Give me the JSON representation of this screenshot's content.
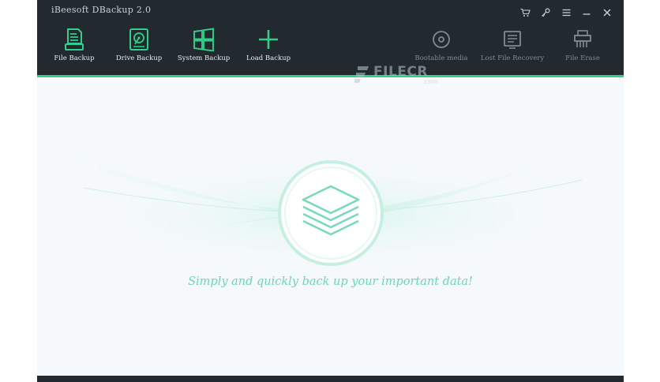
{
  "window": {
    "title": "iBeesoft DBackup 2.0",
    "controls": [
      "cart-icon",
      "key-icon",
      "menu-icon",
      "minimize-icon",
      "close-icon"
    ]
  },
  "toolbar": {
    "primary": [
      {
        "label": "File Backup",
        "icon": "file-backup-icon"
      },
      {
        "label": "Drive Backup",
        "icon": "drive-backup-icon"
      },
      {
        "label": "System Backup",
        "icon": "system-backup-icon"
      },
      {
        "label": "Load Backup",
        "icon": "load-backup-icon"
      }
    ],
    "secondary": [
      {
        "label": "Bootable media",
        "icon": "disc-icon"
      },
      {
        "label": "Lost File Recovery",
        "icon": "recovery-icon"
      },
      {
        "label": "File Erase",
        "icon": "shredder-icon"
      }
    ]
  },
  "watermark": {
    "text": "FILECR",
    "sub": ".com"
  },
  "main": {
    "tagline": "Simply and quickly back up your important data!"
  },
  "colors": {
    "topbar": "#232a2f",
    "accent": "#2fd18a",
    "tagline": "#6fd6b4",
    "background": "#f6f9fb"
  }
}
